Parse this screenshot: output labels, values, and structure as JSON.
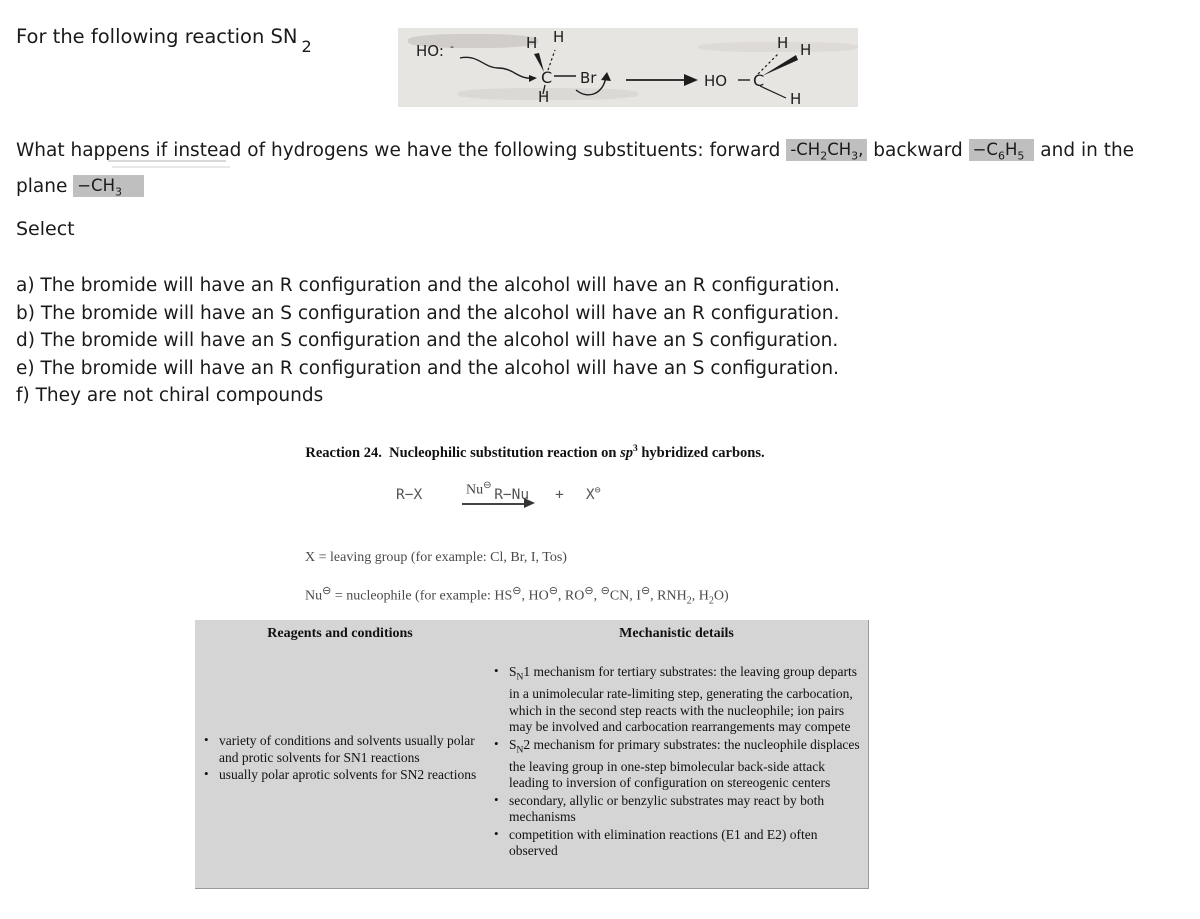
{
  "question": {
    "line1_prefix": "For the following reaction SN",
    "line1_subscript": "2",
    "body_part1": "What happens if instead of hydrogens we have the following substituents: forward ",
    "chip_forward": "-CH2CH3",
    "chip_forward_html": "-CH₂CH₃,",
    "body_part2": " backward ",
    "chip_backward_html": "−C₆H₅",
    "body_part3": " and in the plane ",
    "chip_plane_html": "−CH₃",
    "select_label": "Select"
  },
  "options": [
    "a) The bromide will have an R configuration and the alcohol will have an R configuration.",
    "b) The bromide will have an S configuration and the alcohol will have an R configuration.",
    "d) The bromide will have an S configuration and the alcohol will have an S configuration.",
    "e) The bromide will have an R configuration and the alcohol will have an S configuration.",
    "f) They are not chiral compounds"
  ],
  "scan_image": {
    "alt": "hand-drawn SN2 mechanism: hydroxide attacks bromomethane",
    "nucleophile": "HO:⁻",
    "substrate_center": "C",
    "substrate_h_top_left": "H",
    "substrate_h_top_right": "H",
    "substrate_h_bottom": "H",
    "leaving_group": "Br",
    "product_left": "HO",
    "product_center": "C",
    "product_h_top": "H",
    "product_h_right": "H",
    "product_h_bottom": "H",
    "background_color": "#e7e5e2"
  },
  "figure": {
    "title_prefix": "Reaction 24.",
    "title_main_a": "Nucleophilic substitution reaction on ",
    "title_italic": "sp",
    "title_sup": "3",
    "title_main_b": " hybridized carbons.",
    "scheme": {
      "reactant": "R−X",
      "arrow_label": "Nu",
      "arrow_label_charge": "⊖",
      "product": "R−Nu",
      "plus": "+",
      "byproduct": "X",
      "byproduct_charge": "⊖"
    },
    "definition_x": "X = leaving group (for example: Cl, Br, I, Tos)",
    "definition_nu": "Nu⊖ = nucleophile (for example: HS⊖, HO⊖, RO⊖, ⊖CN, I⊖, RNH₂, H₂O)"
  },
  "table": {
    "header_left": "Reagents and conditions",
    "header_right": "Mechanistic details",
    "left_bullets": [
      "variety of conditions and solvents usually polar and protic solvents for SN1 reactions",
      "usually polar aprotic solvents for SN2 reactions"
    ],
    "right_bullets": [
      "SN1 mechanism for tertiary substrates: the leaving group departs in a unimolecular rate-limiting step, generating the carbocation, which in the second step reacts with the nucleophile; ion pairs may be involved and carbocation rearrangements may compete",
      "SN2 mechanism for primary substrates: the nucleophile displaces the leaving group in one-step bimolecular back-side attack leading to inversion of configuration on stereogenic centers",
      "secondary, allylic or benzylic substrates may react by both mechanisms",
      "competition with elimination reactions (E1 and E2) often observed"
    ],
    "background_color": "#d5d5d5"
  }
}
